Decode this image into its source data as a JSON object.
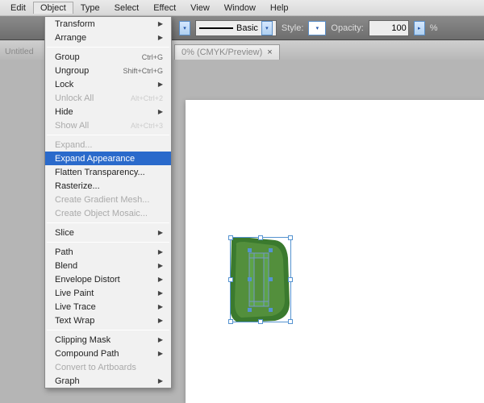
{
  "menubar": {
    "items": [
      "Edit",
      "Object",
      "Type",
      "Select",
      "Effect",
      "View",
      "Window",
      "Help"
    ],
    "active_index": 1
  },
  "toolbar": {
    "basic": "Basic",
    "style": "Style:",
    "opacity_label": "Opacity:",
    "opacity_value": "100",
    "pct": "%"
  },
  "doc_tab": {
    "prefix": "Untitled",
    "remain": "0% (CMYK/Preview)",
    "close": "×"
  },
  "dropdown": [
    {
      "label": "Transform",
      "sub": "",
      "arrow": true
    },
    {
      "label": "Arrange",
      "sub": "",
      "arrow": true
    },
    {
      "sep": true
    },
    {
      "label": "Group",
      "sub": "Ctrl+G"
    },
    {
      "label": "Ungroup",
      "sub": "Shift+Ctrl+G"
    },
    {
      "label": "Lock",
      "sub": "",
      "arrow": true
    },
    {
      "label": "Unlock All",
      "sub": "Alt+Ctrl+2",
      "disabled": true
    },
    {
      "label": "Hide",
      "sub": "",
      "arrow": true
    },
    {
      "label": "Show All",
      "sub": "Alt+Ctrl+3",
      "disabled": true
    },
    {
      "sep": true
    },
    {
      "label": "Expand...",
      "disabled": true
    },
    {
      "label": "Expand Appearance",
      "hover": true
    },
    {
      "label": "Flatten Transparency..."
    },
    {
      "label": "Rasterize..."
    },
    {
      "label": "Create Gradient Mesh...",
      "disabled": true
    },
    {
      "label": "Create Object Mosaic...",
      "disabled": true
    },
    {
      "sep": true
    },
    {
      "label": "Slice",
      "arrow": true
    },
    {
      "sep": true
    },
    {
      "label": "Path",
      "arrow": true
    },
    {
      "label": "Blend",
      "arrow": true
    },
    {
      "label": "Envelope Distort",
      "arrow": true
    },
    {
      "label": "Live Paint",
      "arrow": true
    },
    {
      "label": "Live Trace",
      "arrow": true
    },
    {
      "label": "Text Wrap",
      "arrow": true
    },
    {
      "sep": true
    },
    {
      "label": "Clipping Mask",
      "arrow": true
    },
    {
      "label": "Compound Path",
      "arrow": true
    },
    {
      "label": "Convert to Artboards",
      "disabled": true
    },
    {
      "label": "Graph",
      "arrow": true
    }
  ]
}
